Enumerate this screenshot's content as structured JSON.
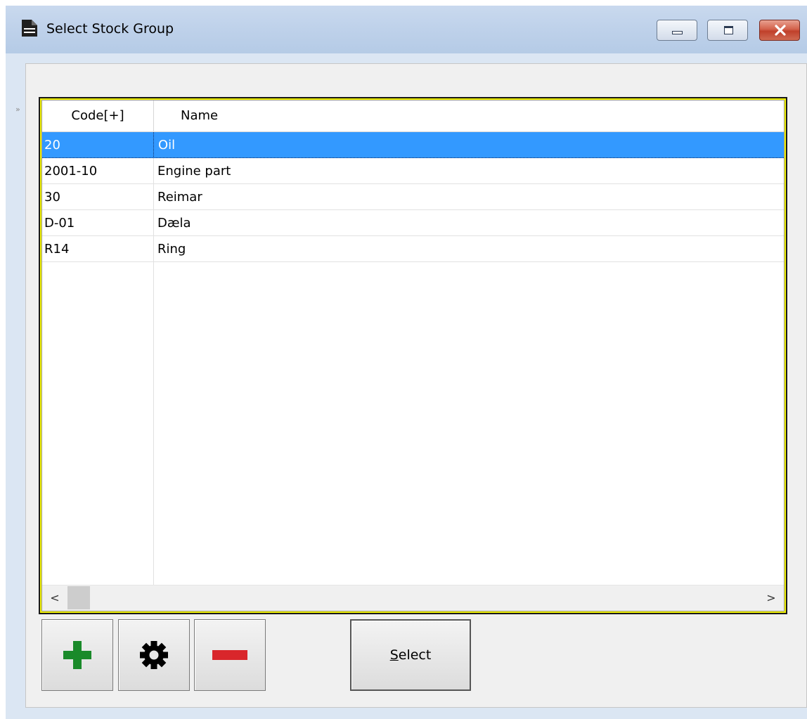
{
  "window": {
    "title": "Select Stock Group",
    "icons": {
      "app": "document-icon",
      "minimize": "minimize-icon",
      "maximize": "maximize-icon",
      "close": "close-icon"
    },
    "colors": {
      "selection": "#3399ff",
      "grid_border_highlight": "#f2f200",
      "add_icon": "#1a8a2a",
      "remove_icon": "#d9262b"
    }
  },
  "grid": {
    "columns": [
      {
        "label": "Code[+]"
      },
      {
        "label": "Name"
      }
    ],
    "rows": [
      {
        "code": "20",
        "name": "Oil",
        "selected": true
      },
      {
        "code": "2001-10",
        "name": "Engine part",
        "selected": false
      },
      {
        "code": "30",
        "name": "Reimar",
        "selected": false
      },
      {
        "code": "D-01",
        "name": "Dæla",
        "selected": false
      },
      {
        "code": "R14",
        "name": "Ring",
        "selected": false
      }
    ],
    "scroll_left": "<",
    "scroll_right": ">",
    "row_indicator": "»"
  },
  "toolbar": {
    "add_icon": "plus-icon",
    "settings_icon": "gear-icon",
    "remove_icon": "minus-icon",
    "select_label_mnemonic": "S",
    "select_label_rest": "elect"
  }
}
